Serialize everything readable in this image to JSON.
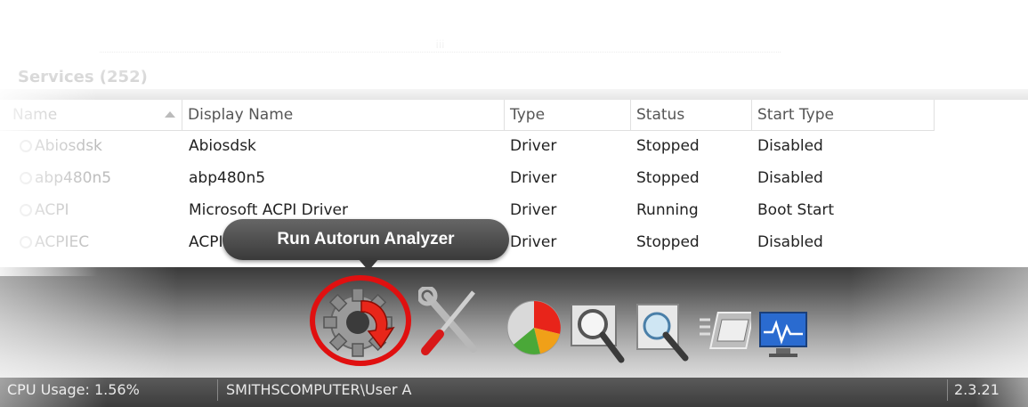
{
  "services": {
    "title": "Services (252)",
    "grip": "iii",
    "columns": {
      "name": "Name",
      "display_name": "Display Name",
      "type": "Type",
      "status": "Status",
      "start_type": "Start Type"
    },
    "rows": [
      {
        "name": "Abiosdsk",
        "display_name": "Abiosdsk",
        "type": "Driver",
        "status": "Stopped",
        "start_type": "Disabled"
      },
      {
        "name": "abp480n5",
        "display_name": "abp480n5",
        "type": "Driver",
        "status": "Stopped",
        "start_type": "Disabled"
      },
      {
        "name": "ACPI",
        "display_name": "Microsoft ACPI Driver",
        "type": "Driver",
        "status": "Running",
        "start_type": "Boot Start"
      },
      {
        "name": "ACPIEC",
        "display_name": "ACPIEC",
        "type": "Driver",
        "status": "Stopped",
        "start_type": "Disabled"
      }
    ]
  },
  "toolbar": {
    "tooltip": "Run Autorun Analyzer",
    "icons": [
      "autorun-analyzer-icon",
      "tools-icon",
      "pie-chart-icon",
      "magnifier-icon",
      "search-document-icon",
      "window-icon",
      "network-monitor-icon"
    ],
    "highlight_color": "#e01010"
  },
  "status_bar": {
    "cpu": "CPU Usage: 1.56%",
    "user": "SMITHSCOMPUTER\\User A",
    "version": "2.3.21"
  }
}
